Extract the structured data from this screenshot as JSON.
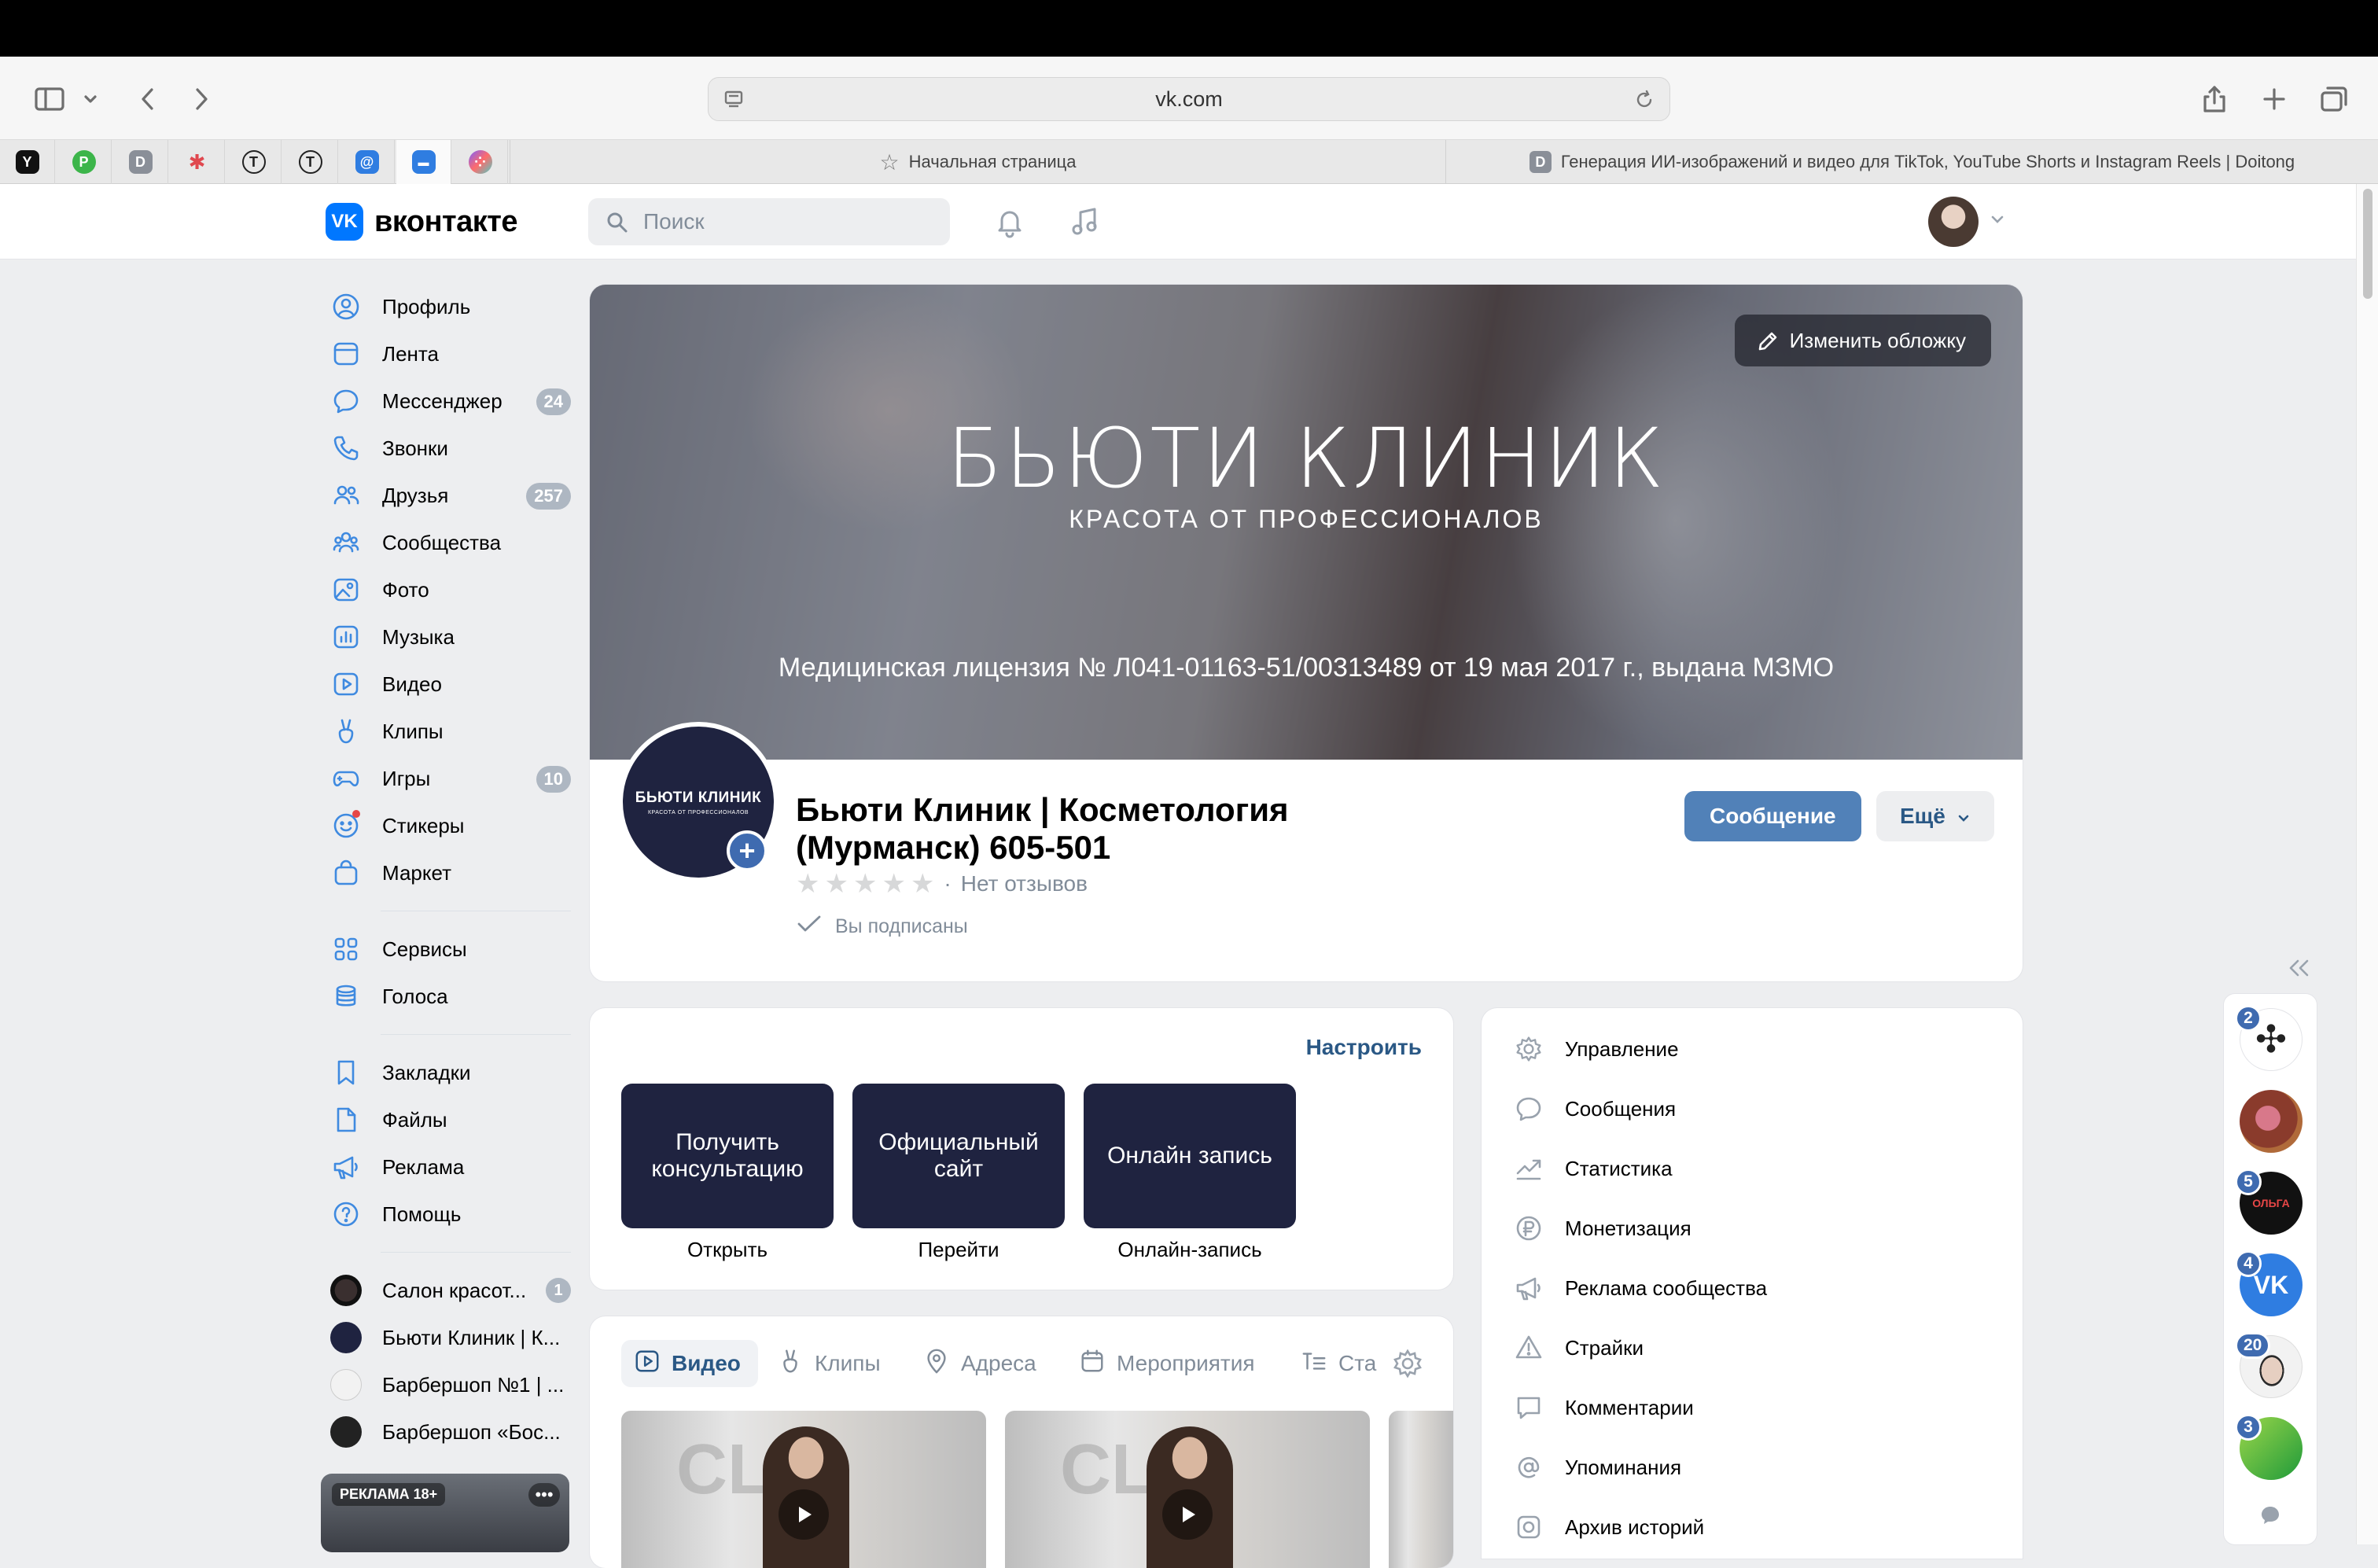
{
  "browser": {
    "url": "vk.com",
    "tabs": [
      {
        "label": "Начальная страница"
      },
      {
        "label": "Генерация ИИ-изображений и видео для TikTok, YouTube Shorts и Instagram Reels | Doitong"
      }
    ],
    "pinned_tabs": [
      {
        "icon": "y-icon",
        "glyph": "Y"
      },
      {
        "icon": "p-icon",
        "glyph": "P"
      },
      {
        "icon": "d-icon",
        "glyph": "D"
      },
      {
        "icon": "star-burst-icon",
        "glyph": "✱"
      },
      {
        "icon": "t-icon",
        "glyph": "T"
      },
      {
        "icon": "t-icon",
        "glyph": "T"
      },
      {
        "icon": "at-icon",
        "glyph": "@"
      },
      {
        "icon": "chat-icon",
        "glyph": "▬"
      },
      {
        "icon": "dots-icon",
        "glyph": "⁘"
      }
    ]
  },
  "header": {
    "logo_text": "вконтакте",
    "logo_mark": "VK",
    "search_placeholder": "Поиск"
  },
  "sidebar": {
    "items": [
      {
        "label": "Профиль",
        "icon": "profile-icon"
      },
      {
        "label": "Лента",
        "icon": "feed-icon"
      },
      {
        "label": "Мессенджер",
        "icon": "messenger-icon",
        "badge": "24"
      },
      {
        "label": "Звонки",
        "icon": "phone-icon"
      },
      {
        "label": "Друзья",
        "icon": "friends-icon",
        "badge": "257"
      },
      {
        "label": "Сообщества",
        "icon": "communities-icon"
      },
      {
        "label": "Фото",
        "icon": "photo-icon"
      },
      {
        "label": "Музыка",
        "icon": "music-icon"
      },
      {
        "label": "Видео",
        "icon": "video-icon"
      },
      {
        "label": "Клипы",
        "icon": "clips-icon"
      },
      {
        "label": "Игры",
        "icon": "games-icon",
        "badge": "10"
      },
      {
        "label": "Стикеры",
        "icon": "stickers-icon"
      },
      {
        "label": "Маркет",
        "icon": "market-icon"
      }
    ],
    "items2": [
      {
        "label": "Сервисы",
        "icon": "services-icon"
      },
      {
        "label": "Голоса",
        "icon": "votes-icon"
      }
    ],
    "items3": [
      {
        "label": "Закладки",
        "icon": "bookmark-icon"
      },
      {
        "label": "Файлы",
        "icon": "file-icon"
      },
      {
        "label": "Реклама",
        "icon": "megaphone-icon"
      },
      {
        "label": "Помощь",
        "icon": "help-icon"
      }
    ],
    "communities": [
      {
        "label": "Салон красот...",
        "badge": "1"
      },
      {
        "label": "Бьюти Клиник | К..."
      },
      {
        "label": "Барбершоп №1 | ..."
      },
      {
        "label": "Барбершоп «Бос..."
      }
    ],
    "ad": {
      "label": "РЕКЛАМА 18+",
      "more": "•••"
    }
  },
  "cover": {
    "title": "БЬЮТИ КЛИНИК",
    "subtitle": "КРАСОТА ОТ ПРОФЕССИОНАЛОВ",
    "license": "Медицинская лицензия № Л041-01163-51/00313489 от 19 мая 2017 г., выдана МЗМО",
    "edit_button": "Изменить обложку"
  },
  "group": {
    "avatar_title": "БЬЮТИ КЛИНИК",
    "avatar_sub": "КРАСОТА ОТ ПРОФЕССИОНАЛОВ",
    "name": "Бьюти Клиник | Косметология (Мурманск) 605-501",
    "reviews": "Нет отзывов",
    "subscribed": "Вы подписаны",
    "message_button": "Сообщение",
    "more_button": "Ещё"
  },
  "links": {
    "configure": "Настроить",
    "tiles": [
      {
        "title": "Получить консультацию",
        "caption": "Открыть"
      },
      {
        "title": "Официальный сайт",
        "caption": "Перейти"
      },
      {
        "title": "Онлайн запись",
        "caption": "Онлайн-запись"
      }
    ]
  },
  "media": {
    "tabs": [
      {
        "label": "Видео",
        "icon": "video-icon"
      },
      {
        "label": "Клипы",
        "icon": "clips-icon"
      },
      {
        "label": "Адреса",
        "icon": "location-icon"
      },
      {
        "label": "Мероприятия",
        "icon": "calendar-icon"
      },
      {
        "label": "Ста",
        "icon": "articles-icon"
      }
    ],
    "thumb_word": "CLIN"
  },
  "manage_menu": [
    {
      "label": "Управление",
      "icon": "gear-icon"
    },
    {
      "label": "Сообщения",
      "icon": "message-icon"
    },
    {
      "label": "Статистика",
      "icon": "chart-icon"
    },
    {
      "label": "Монетизация",
      "icon": "ruble-icon"
    },
    {
      "label": "Реклама сообщества",
      "icon": "megaphone-icon"
    },
    {
      "label": "Страйки",
      "icon": "warning-icon"
    },
    {
      "label": "Комментарии",
      "icon": "comment-icon"
    },
    {
      "label": "Упоминания",
      "icon": "at-icon"
    },
    {
      "label": "Архив историй",
      "icon": "archive-icon"
    }
  ],
  "chat_rail": [
    {
      "badge": "2"
    },
    {
      "badge": ""
    },
    {
      "badge": "5",
      "text": "ОЛЬГА"
    },
    {
      "badge": "4"
    },
    {
      "badge": "20"
    },
    {
      "badge": "3"
    }
  ],
  "colors": {
    "accent": "#5181b8",
    "link": "#2a5885",
    "icon_blue": "#3f8ae0",
    "tile_bg": "#1f2340"
  }
}
